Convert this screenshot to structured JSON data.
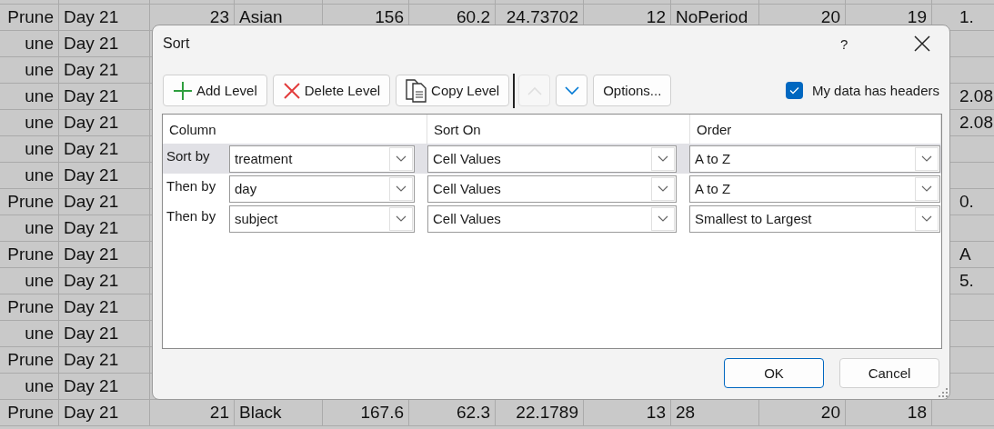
{
  "spreadsheet": {
    "rows": [
      {
        "column_1": "Prune",
        "column_2": "Day 21",
        "column_3": "23",
        "column_4": "Asian",
        "column_5": "156",
        "column_6": "60.2",
        "column_7": "24.73702",
        "column_8": "12",
        "column_9": "NoPeriod",
        "column_10": "20",
        "column_11": "19",
        "column_12": "1."
      },
      {
        "column_1": "une",
        "column_2": "Day 21"
      },
      {
        "column_1": "une",
        "column_2": "Day 21"
      },
      {
        "column_1": "une",
        "column_2": "Day 21",
        "column_12": "2.08"
      },
      {
        "column_1": "une",
        "column_2": "Day 21",
        "column_12": "2.08"
      },
      {
        "column_1": "une",
        "column_2": "Day 21"
      },
      {
        "column_1": "une",
        "column_2": "Day 21"
      },
      {
        "column_1": "Prune",
        "column_2": "Day 21",
        "column_12": "0."
      },
      {
        "column_1": "une",
        "column_2": "Day 21"
      },
      {
        "column_1": "Prune",
        "column_2": "Day 21",
        "column_12": "A"
      },
      {
        "column_1": "une",
        "column_2": "Day 21",
        "column_12": "5."
      },
      {
        "column_1": "Prune",
        "column_2": "Day 21"
      },
      {
        "column_1": "une",
        "column_2": "Day 21"
      },
      {
        "column_1": "Prune",
        "column_2": "Day 21"
      },
      {
        "column_1": "une",
        "column_2": "Day 21"
      },
      {
        "column_1": "Prune",
        "column_2": "Day 21",
        "column_3": "21",
        "column_4": "Black",
        "column_5": "167.6",
        "column_6": "62.3",
        "column_7": "22.1789",
        "column_8": "13",
        "column_9": "28",
        "column_10": "20",
        "column_11": "18"
      }
    ]
  },
  "dialog": {
    "title": "Sort",
    "help": "?",
    "toolbar": [
      {
        "kind": "add",
        "label": "Add Level",
        "disabled": false
      },
      {
        "kind": "delete",
        "label": "Delete Level",
        "disabled": false
      },
      {
        "kind": "copy",
        "label": "Copy Level",
        "disabled": false
      },
      {
        "kind": "up",
        "disabled": true
      },
      {
        "kind": "down",
        "disabled": false
      },
      {
        "kind": "options",
        "label": "Options...",
        "disabled": false
      }
    ],
    "headers_checkbox": {
      "label": "My data has headers",
      "checked": true
    },
    "columns": [
      "Column",
      "Sort On",
      "Order"
    ],
    "levels": [
      {
        "label": "Sort by",
        "column": "treatment",
        "sort_on": "Cell Values",
        "order": "A to Z",
        "selected": true
      },
      {
        "label": "Then by",
        "column": "day",
        "sort_on": "Cell Values",
        "order": "A to Z",
        "selected": false
      },
      {
        "label": "Then by",
        "column": "subject",
        "sort_on": "Cell Values",
        "order": "Smallest to Largest",
        "selected": false
      }
    ],
    "buttons": [
      {
        "label": "OK",
        "default": true
      },
      {
        "label": "Cancel",
        "default": false
      }
    ]
  }
}
